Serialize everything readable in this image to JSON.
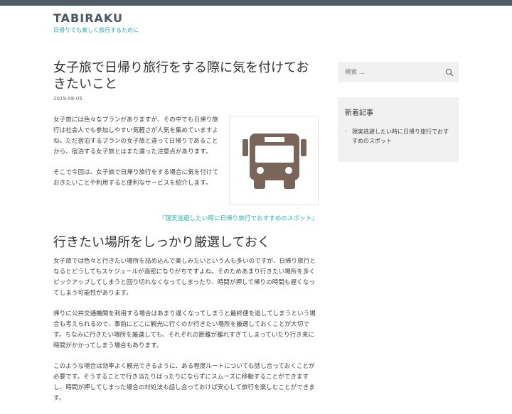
{
  "site": {
    "title": "TABIRAKU",
    "description": "日帰りでも楽しく旅行するために"
  },
  "post": {
    "title": "女子旅で日帰り旅行をする際に気を付けておきたいこと",
    "date": "2019-08-05",
    "intro": [
      "女子旅には色々なプランがありますが、その中でも日帰り旅行は社会人でも参加しやすい気軽さが人気を集めていますよね。ただ宿泊するプランの女子旅と違って日帰りであることから、宿泊する女子旅とはまた違った注意点があります。",
      "そこで今回は、女子旅で日帰り旅行をする場合に気を付けておきたいことや利用すると便利なサービスを紹介します。"
    ],
    "thumbnail_icon": "bus-icon",
    "thumbnail_color": "#7a655a",
    "related_link": "『現実逃避したい時に日帰り旅行でおすすめのスポット』",
    "section_heading": "行きたい場所をしっかり厳選しておく",
    "body": [
      "女子旅では色々と行きたい場所を詰め込んで楽しみたいという人も多いのですが、日帰り旅行となるとどうしてもスケジュールが過密になりがちですよね。そのためあまり行きたい場所を多くピックアップしてしまうと回り切れなくなってしまったり、時間が押して帰りの時間も遅くなってしまう可能性があります。",
      "帰りに公共交通機関を利用する場合はあまり遅くなってしまうと最終便を逃してしまうという場合も考えられるので、事前にどこに観光に行くのか行きたい場所を厳選しておくことが大切です。ちなみに行きたい場所を厳選しても、それぞれの距離が離れすぎてしまっていたり行き来に時間がかかってしまう場合もあります。",
      "このような場合は効率よく観光できるように、ある程度ルートについても話し合っておくことが必要です。そうすることで行き当たりばったりにならずにスムーズに移動することができますし、時間が押してしまった場合の対処法も話し合っておけば安心して旅行を楽しむことができます。"
    ]
  },
  "sidebar": {
    "search": {
      "placeholder": "検索 ...",
      "icon": "search-icon"
    },
    "recent": {
      "title": "新着記事",
      "items": [
        "現実逃避したい時に日帰り旅行でおすすめのスポット"
      ]
    }
  },
  "colors": {
    "topbar": "#4f5a67",
    "accent": "#2aa6bf",
    "link": "#2ab4b0"
  }
}
